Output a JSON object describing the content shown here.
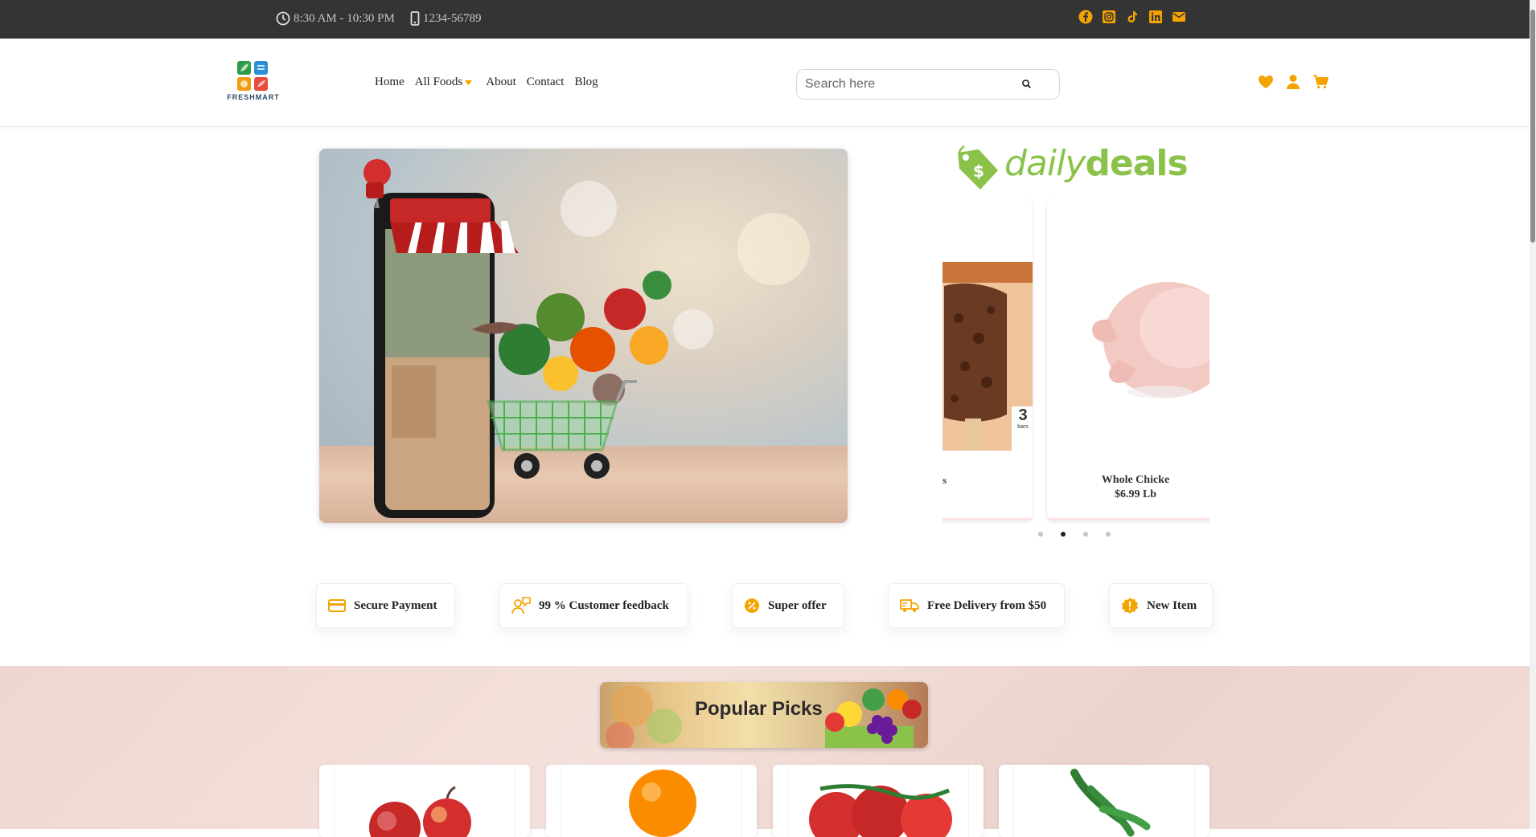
{
  "topbar": {
    "hours": "8:30 AM - 10:30 PM",
    "phone": "1234-56789",
    "social_icons": [
      "facebook-icon",
      "instagram-icon",
      "tiktok-icon",
      "linkedin-icon",
      "email-icon"
    ]
  },
  "header": {
    "logo_text": "FRESHMART",
    "nav": [
      {
        "label": "Home"
      },
      {
        "label": "All Foods"
      },
      {
        "label": "About"
      },
      {
        "label": "Contact"
      },
      {
        "label": "Blog"
      }
    ],
    "search": {
      "placeholder": "Search here",
      "value": ""
    },
    "icons": [
      "heart-icon",
      "user-icon",
      "cart-icon"
    ]
  },
  "deals": {
    "logo_text_light": "daily",
    "logo_text_bold": "deals",
    "cards": [
      {
        "name": "",
        "price": "",
        "image": "ice-cream-bars"
      },
      {
        "name": "Whole Chicke",
        "price": "$6.99 Lb",
        "image": "whole-chicken"
      }
    ],
    "dots": 4,
    "active_dot": 1,
    "partial_label": "s",
    "box_label": "3",
    "box_sublabel": "bars"
  },
  "features": [
    {
      "label": "Secure Payment",
      "icon": "credit-card-icon"
    },
    {
      "label": "99 % Customer feedback",
      "icon": "feedback-icon"
    },
    {
      "label": "Super offer",
      "icon": "discount-icon"
    },
    {
      "label": "Free Delivery from $50",
      "icon": "truck-icon"
    },
    {
      "label": "New Item",
      "icon": "badge-icon"
    }
  ],
  "popular": {
    "title": "Popular Picks",
    "products": [
      {
        "image": "apples"
      },
      {
        "image": "orange"
      },
      {
        "image": "tomatoes"
      },
      {
        "image": "green-chilies"
      }
    ]
  },
  "colors": {
    "accent": "#f5a300",
    "topbar": "#343434",
    "deals_green": "#8bc34a",
    "popular_bg": "#efd6d0"
  }
}
